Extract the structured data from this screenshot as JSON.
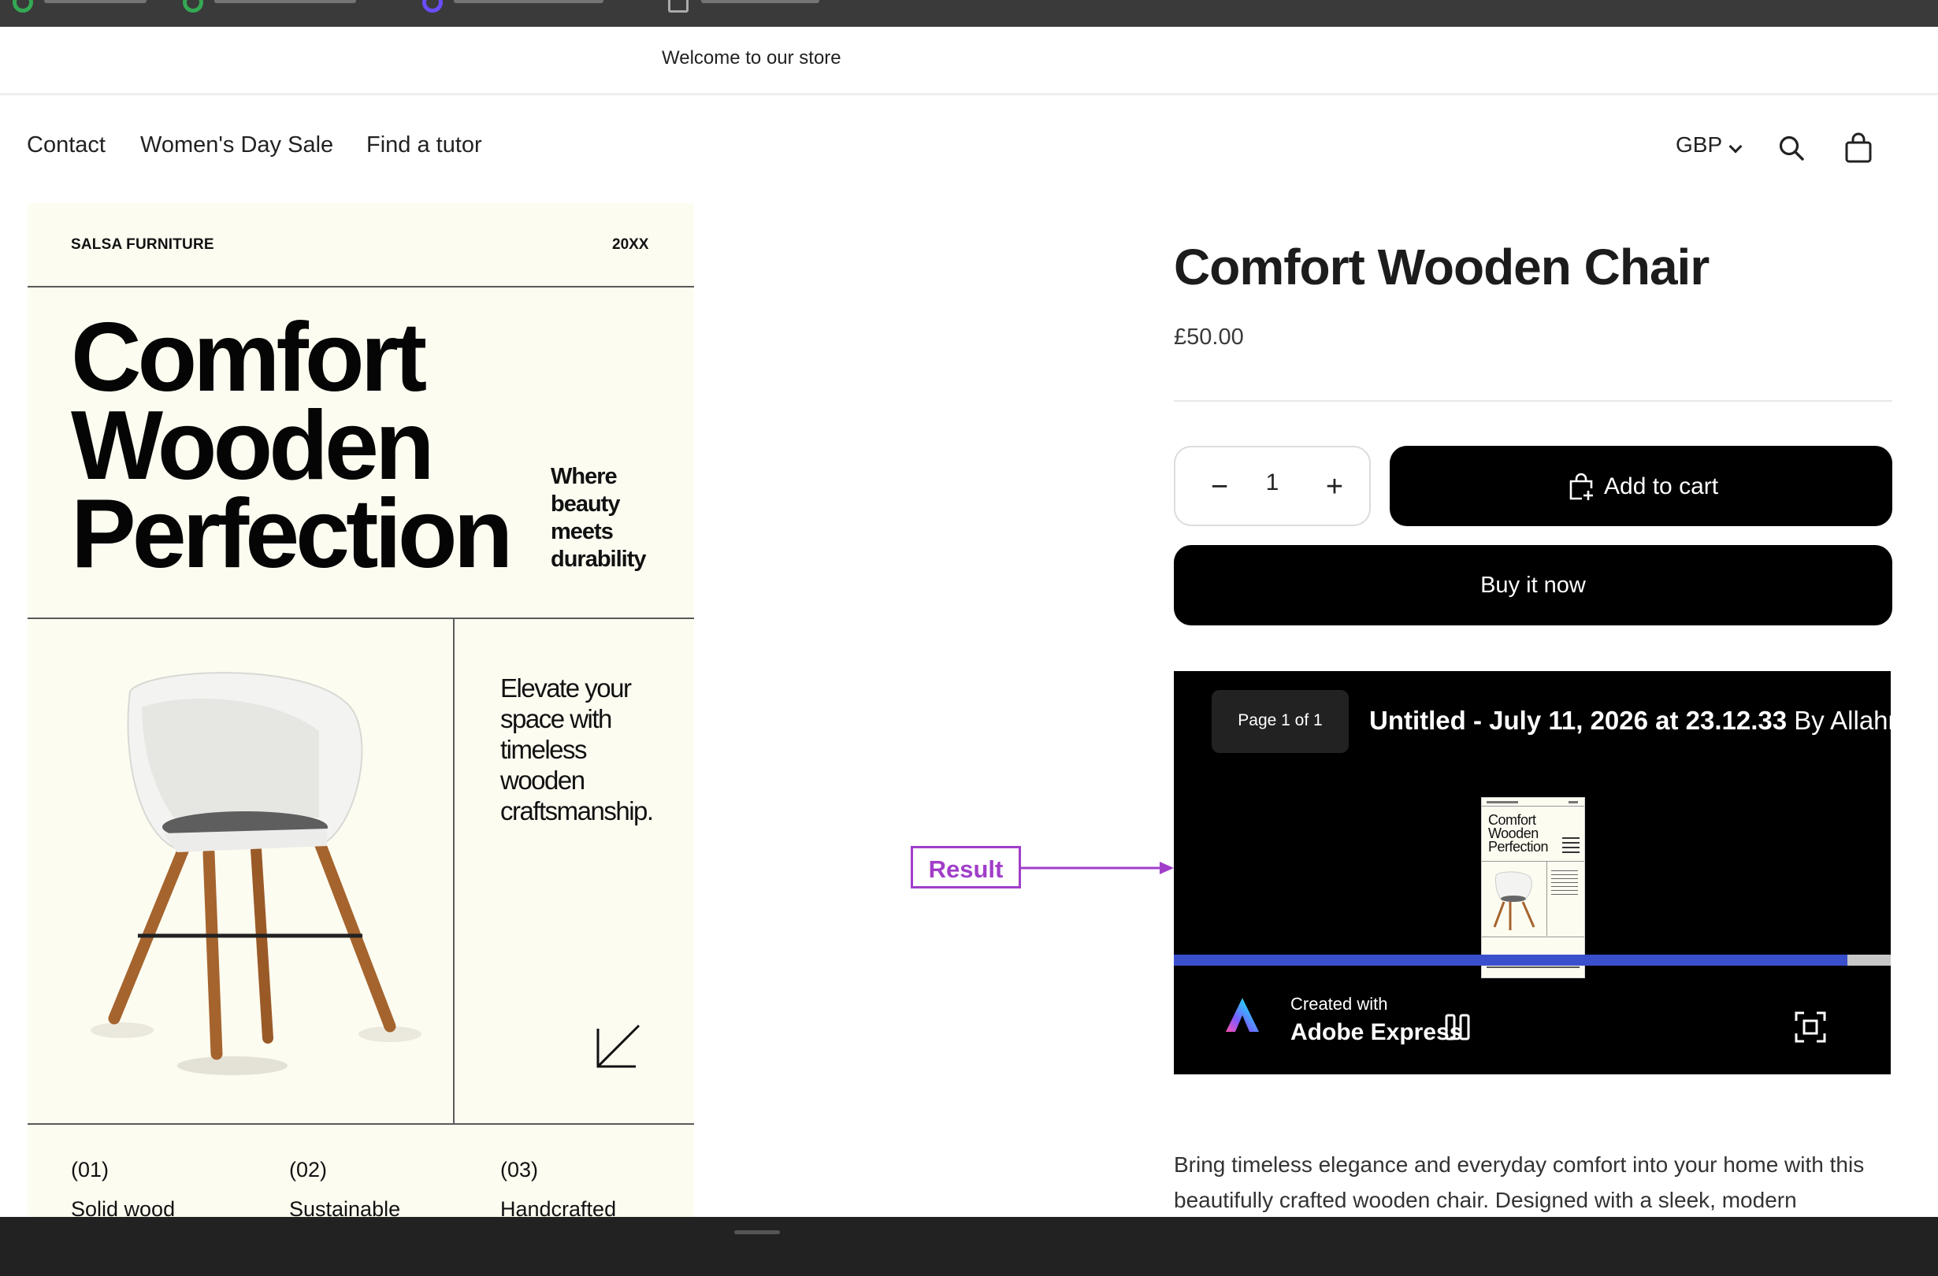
{
  "announcement": "Welcome to our store",
  "nav": {
    "links": [
      "Contact",
      "Women's Day Sale",
      "Find a tutor"
    ],
    "currency": "GBP"
  },
  "poster": {
    "brand": "SALSA FURNITURE",
    "year": "20XX",
    "title": [
      "Comfort",
      "Wooden",
      "Perfection"
    ],
    "tagline": [
      "Where",
      "beauty",
      "meets",
      "durability"
    ],
    "elevate": [
      "Elevate your",
      "space with",
      "timeless",
      "wooden",
      "craftsmanship."
    ],
    "features": [
      {
        "num": "(01)",
        "label": "Solid wood"
      },
      {
        "num": "(02)",
        "label": "Sustainable"
      },
      {
        "num": "(03)",
        "label": "Handcrafted"
      }
    ]
  },
  "product": {
    "title": "Comfort Wooden Chair",
    "price": "£50.00",
    "quantity": "1",
    "add_to_cart": "Add to cart",
    "buy_now": "Buy it now"
  },
  "embed": {
    "page_badge": "Page 1 of 1",
    "title": "Untitled - July 11, 2026 at 23.12.33",
    "by": "By Allahrak",
    "created_with": "Created with",
    "brand": "Adobe Express",
    "progress": 0.94
  },
  "annotation": {
    "label": "Result",
    "color": "#a13ec9"
  },
  "description": "Bring timeless elegance and everyday comfort into your home with this beautifully crafted wooden chair. Designed with a sleek, modern",
  "colors": {
    "progress": "#3a4fcc",
    "button": "#000000",
    "poster_bg": "#fdfcf1"
  }
}
